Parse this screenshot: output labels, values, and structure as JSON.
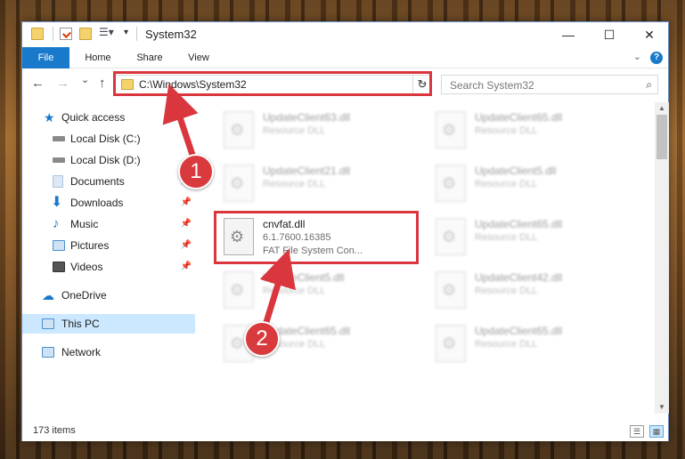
{
  "window": {
    "title": "System32"
  },
  "title_buttons": {
    "minimize": "—",
    "maximize": "☐",
    "close": "✕"
  },
  "ribbon": {
    "tabs": [
      "File",
      "Home",
      "Share",
      "View"
    ],
    "help": "?",
    "collapse": "⌄"
  },
  "nav": {
    "back": "←",
    "forward": "→",
    "recent": "⌄",
    "up": "↑"
  },
  "address": {
    "path": "C:\\Windows\\System32",
    "dropdown": "⌄",
    "refresh": "↻"
  },
  "search": {
    "placeholder": "Search System32",
    "icon": "⌕"
  },
  "sidebar": {
    "items": [
      {
        "label": "Quick access",
        "icon": "star-icon",
        "color": "#1979ca"
      },
      {
        "label": "Local Disk (C:)",
        "icon": "drive-icon",
        "color": "#8a8a8a"
      },
      {
        "label": "Local Disk (D:)",
        "icon": "drive-icon",
        "color": "#8a8a8a"
      },
      {
        "label": "Documents",
        "icon": "documents-icon",
        "color": "#a9c3de"
      },
      {
        "label": "Downloads",
        "icon": "download-icon",
        "color": "#1979ca"
      },
      {
        "label": "Music",
        "icon": "music-icon",
        "color": "#1979ca"
      },
      {
        "label": "Pictures",
        "icon": "pictures-icon",
        "color": "#4a8fcf"
      },
      {
        "label": "Videos",
        "icon": "videos-icon",
        "color": "#555555"
      },
      {
        "label": "OneDrive",
        "icon": "cloud-icon",
        "color": "#1979ca"
      },
      {
        "label": "This PC",
        "icon": "computer-icon",
        "color": "#4a8fcf"
      },
      {
        "label": "Network",
        "icon": "network-icon",
        "color": "#4a8fcf"
      }
    ],
    "pin": "📌"
  },
  "files": [
    {
      "name": "UpdateClient63.dll",
      "meta1": "Resource DLL",
      "meta2": "",
      "blur": true
    },
    {
      "name": "UpdateClient65.dll",
      "meta1": "Resource DLL",
      "meta2": "",
      "blur": true
    },
    {
      "name": "UpdateClient21.dll",
      "meta1": "Resource DLL",
      "meta2": "",
      "blur": true
    },
    {
      "name": "UpdateClient5.dll",
      "meta1": "Resource DLL",
      "meta2": "",
      "blur": true
    },
    {
      "name": "cnvfat.dll",
      "meta1": "6.1.7600.16385",
      "meta2": "FAT File System Con...",
      "blur": false
    },
    {
      "name": "UpdateClient65.dll",
      "meta1": "Resource DLL",
      "meta2": "",
      "blur": true
    },
    {
      "name": "UpdateClient5.dll",
      "meta1": "Resource DLL",
      "meta2": "",
      "blur": true
    },
    {
      "name": "UpdateClient42.dll",
      "meta1": "Resource DLL",
      "meta2": "",
      "blur": true
    },
    {
      "name": "UpdateClient65.dll",
      "meta1": "Resource DLL",
      "meta2": "",
      "blur": true
    },
    {
      "name": "UpdateClient65.dll",
      "meta1": "Resource DLL",
      "meta2": "",
      "blur": true
    }
  ],
  "status": {
    "count": "173 items"
  },
  "callouts": {
    "one": "1",
    "two": "2"
  },
  "colors": {
    "accent": "#1979ca",
    "highlight": "#d9363e",
    "selected": "#cce8ff"
  }
}
